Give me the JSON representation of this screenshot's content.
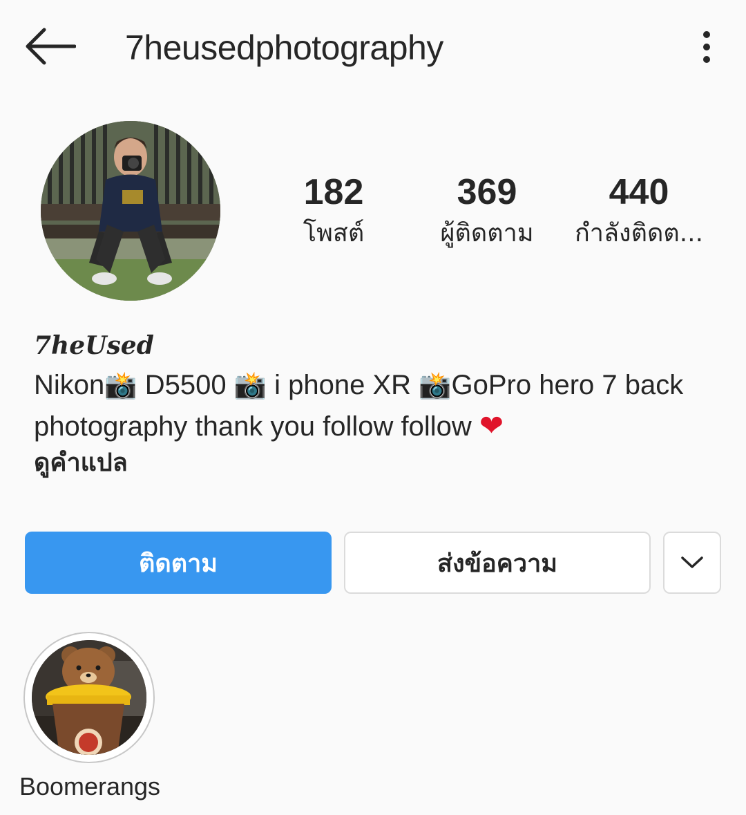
{
  "header": {
    "username": "7heusedphotography"
  },
  "profile": {
    "stats": [
      {
        "value": "182",
        "label": "โพสต์"
      },
      {
        "value": "369",
        "label": "ผู้ติดตาม"
      },
      {
        "value": "440",
        "label": "กำลังติดต..."
      }
    ],
    "display_name": "7heUsed",
    "bio": {
      "seg1": "Nikon",
      "seg2": " D5500  ",
      "seg3": " i phone XR ",
      "seg4": "GoPro hero 7 back",
      "line2": "photography thank you follow follow ",
      "camera_emoji": "📸",
      "heart_emoji": "❤"
    },
    "translate_label": "ดูคำแปล"
  },
  "actions": {
    "follow_label": "ติดตาม",
    "message_label": "ส่งข้อความ"
  },
  "highlights": [
    {
      "label": "Boomerangs"
    }
  ],
  "colors": {
    "accent": "#3897f0",
    "text": "#262626",
    "background": "#fafafa",
    "border": "#dbdbdb",
    "heart": "#e0142b"
  }
}
